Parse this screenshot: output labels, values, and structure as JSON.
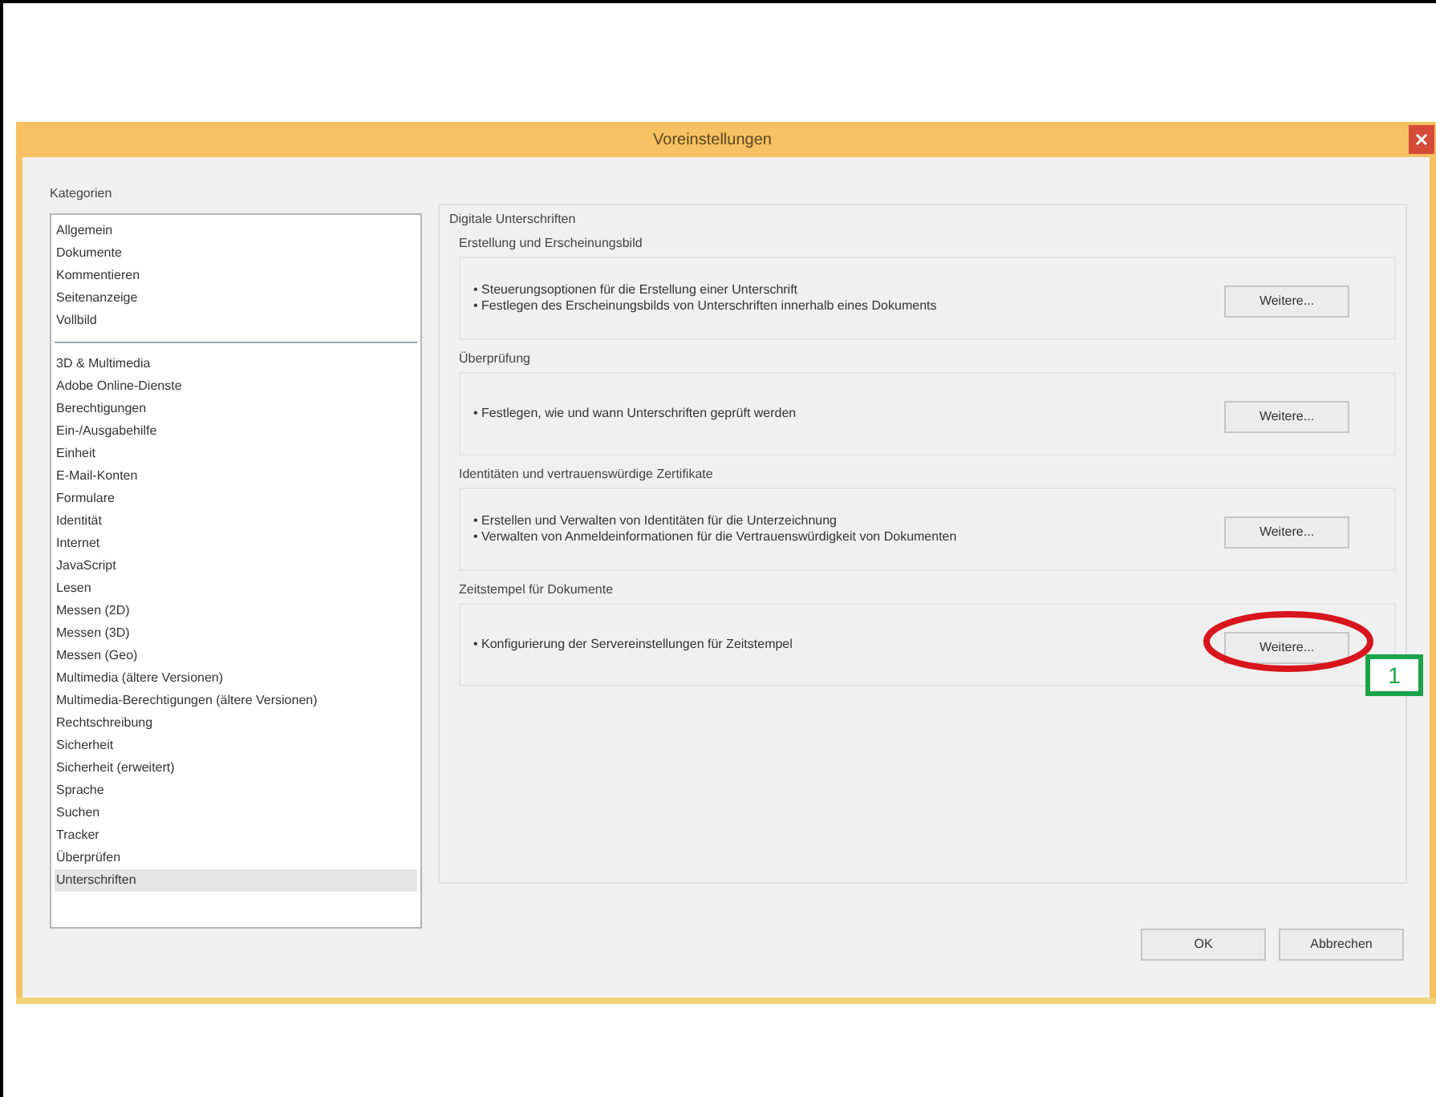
{
  "window": {
    "title": "Voreinstellungen"
  },
  "categories": {
    "label": "Kategorien",
    "groups": [
      {
        "items": [
          {
            "label": "Allgemein",
            "selected": false
          },
          {
            "label": "Dokumente",
            "selected": false
          },
          {
            "label": "Kommentieren",
            "selected": false
          },
          {
            "label": "Seitenanzeige",
            "selected": false
          },
          {
            "label": "Vollbild",
            "selected": false
          }
        ]
      },
      {
        "items": [
          {
            "label": "3D & Multimedia",
            "selected": false
          },
          {
            "label": "Adobe Online-Dienste",
            "selected": false
          },
          {
            "label": "Berechtigungen",
            "selected": false
          },
          {
            "label": "Ein-/Ausgabehilfe",
            "selected": false
          },
          {
            "label": "Einheit",
            "selected": false
          },
          {
            "label": "E-Mail-Konten",
            "selected": false
          },
          {
            "label": "Formulare",
            "selected": false
          },
          {
            "label": "Identität",
            "selected": false
          },
          {
            "label": "Internet",
            "selected": false
          },
          {
            "label": "JavaScript",
            "selected": false
          },
          {
            "label": "Lesen",
            "selected": false
          },
          {
            "label": "Messen (2D)",
            "selected": false
          },
          {
            "label": "Messen (3D)",
            "selected": false
          },
          {
            "label": "Messen (Geo)",
            "selected": false
          },
          {
            "label": "Multimedia (ältere Versionen)",
            "selected": false
          },
          {
            "label": "Multimedia-Berechtigungen (ältere Versionen)",
            "selected": false
          },
          {
            "label": "Rechtschreibung",
            "selected": false
          },
          {
            "label": "Sicherheit",
            "selected": false
          },
          {
            "label": "Sicherheit (erweitert)",
            "selected": false
          },
          {
            "label": "Sprache",
            "selected": false
          },
          {
            "label": "Suchen",
            "selected": false
          },
          {
            "label": "Tracker",
            "selected": false
          },
          {
            "label": "Überprüfen",
            "selected": false
          },
          {
            "label": "Unterschriften",
            "selected": true
          }
        ]
      }
    ]
  },
  "panel": {
    "title": "Digitale Unterschriften",
    "sections": [
      {
        "title": "Erstellung und Erscheinungsbild",
        "bullets": [
          "• Steuerungsoptionen für die Erstellung einer Unterschrift",
          "• Festlegen des Erscheinungsbilds von Unterschriften innerhalb eines Dokuments"
        ],
        "button": "Weitere...",
        "highlighted": false
      },
      {
        "title": "Überprüfung",
        "bullets": [
          "• Festlegen, wie und wann Unterschriften geprüft werden"
        ],
        "button": "Weitere...",
        "highlighted": false
      },
      {
        "title": "Identitäten und vertrauenswürdige Zertifikate",
        "bullets": [
          "• Erstellen und Verwalten von Identitäten für die Unterzeichnung",
          "• Verwalten von Anmeldeinformationen für die Vertrauenswürdigkeit von Dokumenten"
        ],
        "button": "Weitere...",
        "highlighted": false
      },
      {
        "title": "Zeitstempel für Dokumente",
        "bullets": [
          "• Konfigurierung der Servereinstellungen für Zeitstempel"
        ],
        "button": "Weitere...",
        "highlighted": true,
        "callout": "1"
      }
    ]
  },
  "buttons": [
    "OK",
    "Abbrechen"
  ]
}
